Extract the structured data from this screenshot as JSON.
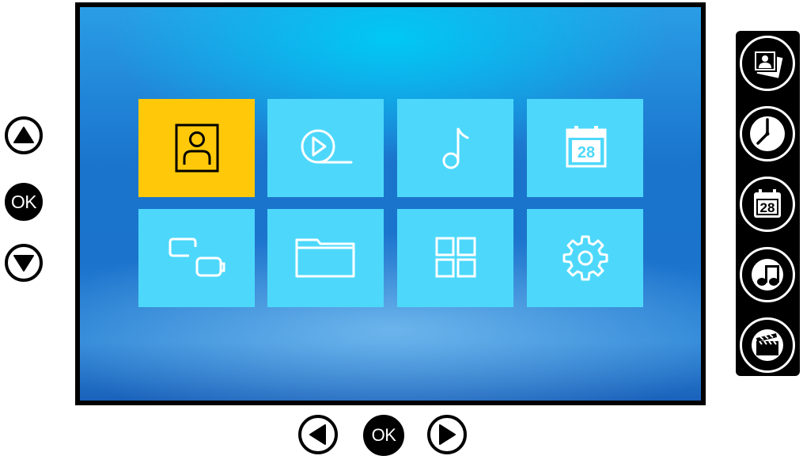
{
  "menu": {
    "tiles": [
      {
        "icon": "contacts-icon",
        "selected": true
      },
      {
        "icon": "video-play-icon",
        "selected": false
      },
      {
        "icon": "music-note-icon",
        "selected": false
      },
      {
        "icon": "calendar-icon",
        "selected": false,
        "date": "28"
      },
      {
        "icon": "devices-icon",
        "selected": false
      },
      {
        "icon": "folder-icon",
        "selected": false
      },
      {
        "icon": "apps-grid-icon",
        "selected": false
      },
      {
        "icon": "settings-gear-icon",
        "selected": false
      }
    ],
    "selected_color": "#ffc90a",
    "tile_color": "#4dd8fb"
  },
  "left_controls": {
    "up": "up-arrow-icon",
    "ok_label": "OK",
    "down": "down-arrow-icon"
  },
  "bottom_controls": {
    "left": "left-arrow-icon",
    "ok_label": "OK",
    "right": "right-arrow-icon"
  },
  "shortcuts": {
    "items": [
      {
        "icon": "photos-icon"
      },
      {
        "icon": "clock-icon"
      },
      {
        "icon": "calendar-icon",
        "date": "28"
      },
      {
        "icon": "music-icon"
      },
      {
        "icon": "clapperboard-icon"
      }
    ]
  },
  "tile_calendar_date": "28",
  "shortcut_calendar_date": "28"
}
